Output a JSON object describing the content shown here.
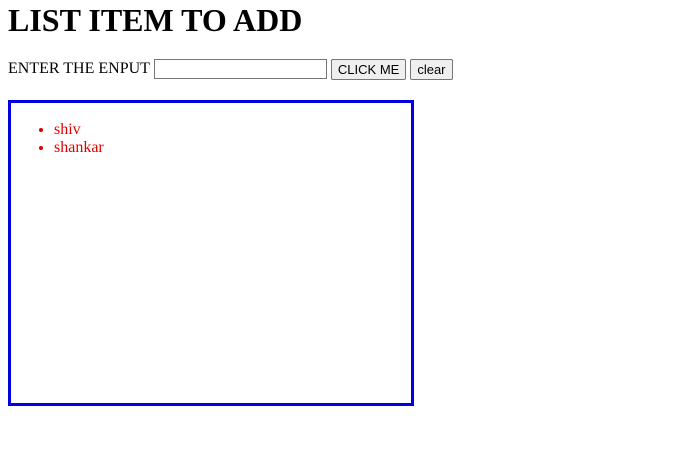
{
  "page": {
    "title": "LIST ITEM TO ADD"
  },
  "form": {
    "label": "ENTER THE ENPUT",
    "input_value": "",
    "click_label": "CLICK ME",
    "clear_label": "clear"
  },
  "list": {
    "items": [
      {
        "label": "shiv"
      },
      {
        "label": "shankar"
      }
    ]
  },
  "colors": {
    "box_border": "#0000e0",
    "item_text": "#e00000"
  }
}
